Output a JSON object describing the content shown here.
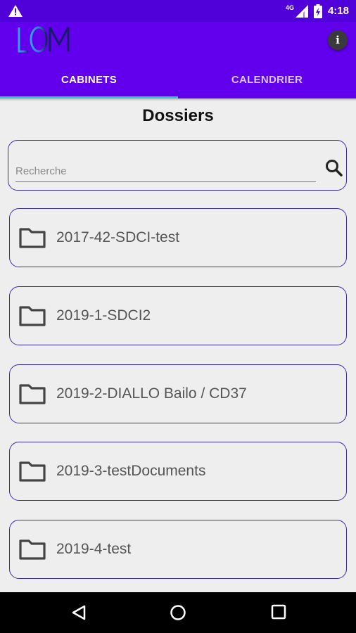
{
  "status_bar": {
    "time": "4:18",
    "network": "4G",
    "icons": [
      "warning-icon",
      "signal-icon",
      "battery-icon"
    ]
  },
  "app": {
    "logo_text": "LOM",
    "tabs": [
      {
        "label": "CABINETS",
        "active": true
      },
      {
        "label": "CALENDRIER",
        "active": false
      }
    ]
  },
  "main": {
    "title": "Dossiers",
    "search": {
      "placeholder": "Recherche",
      "value": ""
    },
    "folders": [
      {
        "label": "2017-42-SDCI-test"
      },
      {
        "label": "2019-1-SDCI2"
      },
      {
        "label": "2019-2-DIALLO Bailo / CD37"
      },
      {
        "label": "2019-3-testDocuments"
      },
      {
        "label": "2019-4-test"
      }
    ]
  },
  "colors": {
    "primary": "#6200ee",
    "status_bar": "#5000d8",
    "tab_indicator": "#26d0c6",
    "outline": "#3b2ca8",
    "background": "#eeeeee"
  }
}
